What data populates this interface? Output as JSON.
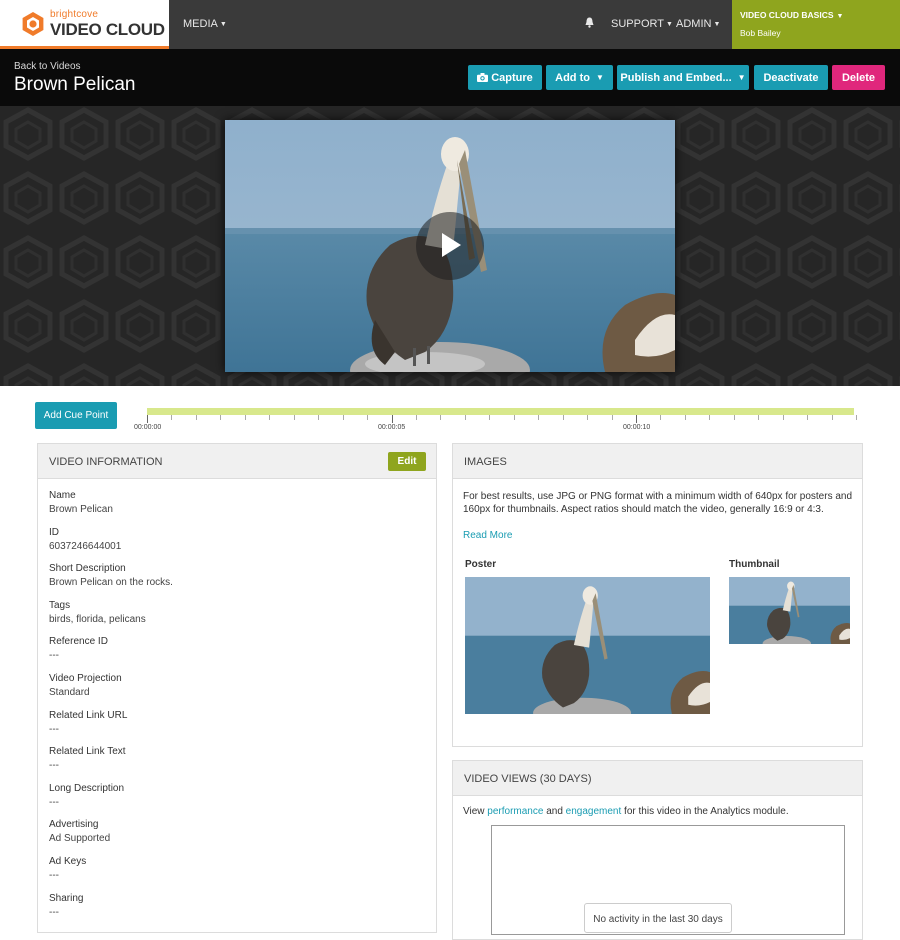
{
  "topbar": {
    "logo_small": "brightcove",
    "logo_big": "VIDEO CLOUD",
    "media_label": "MEDIA",
    "support_label": "SUPPORT",
    "admin_label": "ADMIN",
    "account_title": "VIDEO CLOUD BASICS",
    "account_user": "Bob Bailey"
  },
  "header": {
    "back_link": "Back to Videos",
    "title": "Brown Pelican",
    "buttons": {
      "capture": "Capture",
      "add_to": "Add to",
      "publish": "Publish and Embed...",
      "deactivate": "Deactivate",
      "delete": "Delete"
    }
  },
  "cue": {
    "button_label": "Add Cue Point",
    "time_labels": [
      "00:00:00",
      "00:00:05",
      "00:00:10"
    ]
  },
  "video_info": {
    "heading": "VIDEO INFORMATION",
    "edit_label": "Edit",
    "fields": [
      {
        "label": "Name",
        "value": "Brown Pelican"
      },
      {
        "label": "ID",
        "value": "6037246644001"
      },
      {
        "label": "Short Description",
        "value": "Brown Pelican on the rocks."
      },
      {
        "label": "Tags",
        "value": "birds, florida, pelicans"
      },
      {
        "label": "Reference ID",
        "value": "---"
      },
      {
        "label": "Video Projection",
        "value": "Standard"
      },
      {
        "label": "Related Link URL",
        "value": "---"
      },
      {
        "label": "Related Link Text",
        "value": "---"
      },
      {
        "label": "Long Description",
        "value": "---"
      },
      {
        "label": "Advertising",
        "value": "Ad Supported"
      },
      {
        "label": "Ad Keys",
        "value": "---"
      },
      {
        "label": "Sharing",
        "value": "---"
      }
    ]
  },
  "images": {
    "heading": "IMAGES",
    "description": "For best results, use JPG or PNG format with a minimum width of 640px for posters and 160px for thumbnails. Aspect ratios should match the video, generally 16:9 or 4:3.",
    "read_more": "Read More",
    "poster_label": "Poster",
    "thumbnail_label": "Thumbnail"
  },
  "views": {
    "heading": "VIDEO VIEWS (30 DAYS)",
    "text_before": "View ",
    "link_performance": "performance",
    "text_mid": " and ",
    "link_engagement": "engagement",
    "text_after": " for this video in the Analytics module.",
    "no_activity": "No activity in the last 30 days"
  },
  "colors": {
    "accent_teal": "#1a9cb2",
    "delete_pink": "#e0277c",
    "account_green": "#8fa51e",
    "logo_orange": "#f07b2a",
    "timeline_green": "#d8e88c"
  },
  "icons": [
    "camera-icon",
    "play-icon",
    "notification-icon",
    "caret-down-icon"
  ]
}
